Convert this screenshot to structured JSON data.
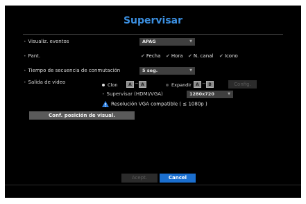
{
  "title": "Supervisar",
  "rows": {
    "eventos": {
      "label": "Visualiz. eventos",
      "value": "APAG"
    },
    "pant": {
      "label": "Pant.",
      "options": [
        "Fecha",
        "Hora",
        "N. canal",
        "Icono"
      ]
    },
    "secuencia": {
      "label": "Tiempo de secuencia de conmutación",
      "value": "5 seg."
    },
    "salida": {
      "label": "Salida de vídeo",
      "clon_label": "Clon",
      "expandir_label": "Expandir",
      "mon_a": "A",
      "mon_b": "B",
      "config_label": "Config.",
      "supervisar_label": "Supervisar (HDMI/VGA)",
      "resolution": "1280x720",
      "warning": "Resolución VGA compatible ( ≤ 1080p )"
    }
  },
  "conf_button": "Conf. posición de visual.",
  "footer": {
    "accept_label": "Acept.",
    "cancel_label": "Cancel"
  },
  "colors": {
    "accent": "#3b8fe0",
    "background": "#000000",
    "cancel_button": "#1b6fcf"
  }
}
